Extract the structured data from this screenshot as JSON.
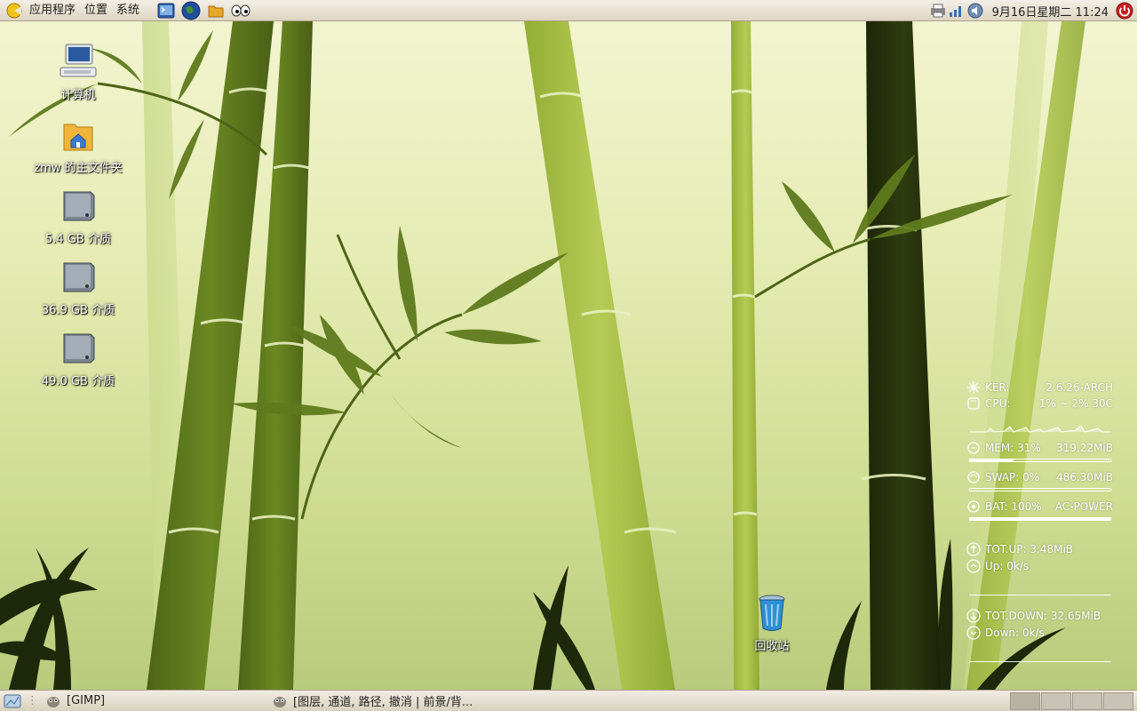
{
  "top_panel": {
    "menus": [
      "应用程序",
      "位置",
      "系统"
    ],
    "launchers": [
      "terminal-icon",
      "web-browser-icon",
      "file-manager-icon",
      "eyes-icon"
    ],
    "tray_icons": [
      "printer-icon",
      "network-icon",
      "volume-icon"
    ],
    "clock": "9月16日星期二 11:24"
  },
  "desktop": {
    "icons": [
      {
        "label": "计算机",
        "icon": "computer-icon"
      },
      {
        "label": "zmw 的主文件夹",
        "icon": "home-folder-icon"
      },
      {
        "label": "5.4 GB 介质",
        "icon": "drive-icon"
      },
      {
        "label": "36.9 GB 介质",
        "icon": "drive-icon"
      },
      {
        "label": "49.0 GB 介质",
        "icon": "drive-icon"
      },
      {
        "label": "回收站",
        "icon": "trash-icon"
      }
    ]
  },
  "conky": {
    "kernel": {
      "key": "KER:",
      "value": "2.6.26-ARCH"
    },
    "cpu": {
      "key": "CPU:",
      "value": "1% ~ 2%  30C"
    },
    "mem": {
      "key": "MEM: 31%",
      "value": "319.22MiB",
      "percent": 31
    },
    "swap": {
      "key": "SWAP: 0%",
      "value": "486.30MiB",
      "percent": 0
    },
    "battery": {
      "key": "BAT: 100%",
      "value": "AC-POWER",
      "percent": 100
    },
    "tot_up": "TOT.UP: 3.48MiB",
    "up": "Up: 0k/s",
    "tot_down": "TOT.DOWN: 32.65MiB",
    "down": "Down: 0k/s"
  },
  "bottom_panel": {
    "tasks": [
      {
        "label": "[GIMP]",
        "icon": "gimp-icon"
      },
      {
        "label": "[图层, 通道, 路径, 撤消 | 前景/背...",
        "icon": "gimp-icon"
      }
    ],
    "workspace_count": 4
  },
  "colors": {
    "panel_bg": "#e6dfcf",
    "bamboo_dark": "#2e3a10",
    "bamboo_mid": "#5f7a1d",
    "bamboo_light": "#a9c14a"
  }
}
